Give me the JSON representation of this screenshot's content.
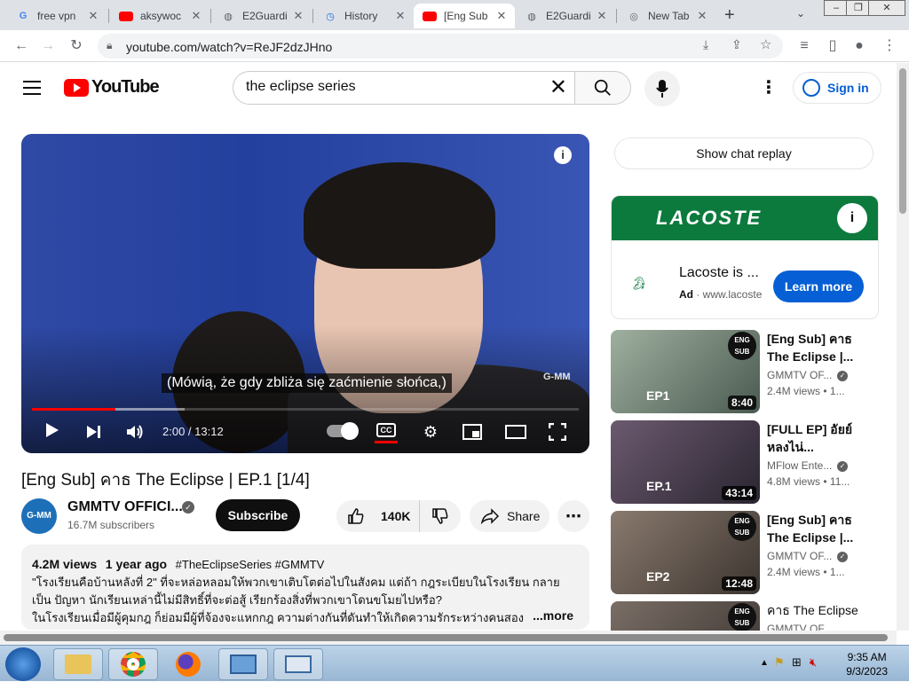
{
  "browser": {
    "tabs": [
      {
        "title": "free vpn",
        "icon": "google-icon"
      },
      {
        "title": "aksywoc",
        "icon": "youtube-icon"
      },
      {
        "title": "E2Guardi",
        "icon": "globe-icon"
      },
      {
        "title": "History",
        "icon": "history-icon"
      },
      {
        "title": "[Eng Sub",
        "icon": "youtube-icon"
      },
      {
        "title": "E2Guardi",
        "icon": "globe-icon"
      },
      {
        "title": "New Tab",
        "icon": "chrome-icon"
      }
    ],
    "url": "youtube.com/watch?v=ReJF2dzJHno"
  },
  "header": {
    "logo_text": "YouTube",
    "search_value": "the eclipse series",
    "signin_label": "Sign in"
  },
  "player": {
    "subtitle": "(Mówią, że gdy zbliża się zaćmienie słońca,)",
    "time_display": "2:00 / 13:12",
    "progress": 0.152,
    "cc_label": "CC",
    "watermark": "G-MM"
  },
  "video": {
    "title": "[Eng Sub] คาธ The Eclipse | EP.1 [1/4]",
    "channel_name": "GMMTV OFFICI...",
    "channel_avatar": "G-MM",
    "subscribers": "16.7M subscribers",
    "subscribe_label": "Subscribe",
    "likes": "140K",
    "share_label": "Share"
  },
  "description": {
    "views": "4.2M views",
    "age": "1 year ago",
    "tags": "#TheEclipseSeries #GMMTV",
    "line1": "\"โรงเรียนคือบ้านหลังที่ 2\" ที่จะหล่อหลอมให้พวกเขาเติบโตต่อไปในสังคม แต่ถ้า กฎระเบียบในโรงเรียน กลาย",
    "line2": "เป็น ปัญหา นักเรียนเหล่านี้ไม่มีสิทธิ์ที่จะต่อสู้ เรียกร้องสิ่งที่พวกเขาโดนขโมยไปหรือ?",
    "line3": "ในโรงเรียนเมื่อมีผู้คุมกฎ ก็ย่อมมีผู้ที่จ้องจะแหกกฎ ความต่างกันที่ดันทำให้เกิดความรักระหว่างคนสอง",
    "more_label": "...more"
  },
  "sidebar": {
    "chat_replay_label": "Show chat replay",
    "ad": {
      "banner_text": "LACOSTE",
      "title": "Lacoste is ...",
      "ad_label": "Ad",
      "domain": "www.lacoste",
      "cta_label": "Learn more"
    },
    "recommendations": [
      {
        "title": "[Eng Sub] คาธ The Eclipse |...",
        "channel": "GMMTV OF...",
        "views": "2.4M views",
        "age": "1...",
        "duration": "8:40",
        "ep": "EP1",
        "badge": "ENG SUB",
        "verified": true
      },
      {
        "title": "[FULL EP] อัยย์หลงไน่...",
        "channel": "MFlow Ente...",
        "views": "4.8M views",
        "age": "11...",
        "duration": "43:14",
        "ep": "EP.1",
        "badge": "",
        "verified": true
      },
      {
        "title": "[Eng Sub] คาธ The Eclipse |...",
        "channel": "GMMTV OF...",
        "views": "2.4M views",
        "age": "1...",
        "duration": "12:48",
        "ep": "EP2",
        "badge": "ENG SUB",
        "verified": true
      },
      {
        "title": "คาธ The Eclipse",
        "channel": "GMMTV OF...",
        "views": "",
        "age": "",
        "duration": "",
        "ep": "",
        "badge": "ENG SUB",
        "verified": false
      }
    ]
  },
  "taskbar": {
    "time": "9:35 AM",
    "date": "9/3/2023"
  },
  "colors": {
    "yt_red": "#ff0000",
    "link_blue": "#065fd4",
    "lacoste_green": "#0c7a3d"
  }
}
